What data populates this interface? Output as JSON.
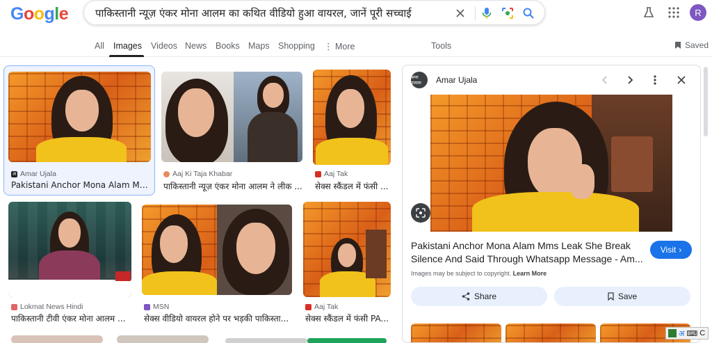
{
  "logo": {
    "letters": [
      "G",
      "o",
      "o",
      "g",
      "l",
      "e"
    ],
    "colors": [
      "#4285f4",
      "#ea4335",
      "#fbbc05",
      "#4285f4",
      "#34a853",
      "#ea4335"
    ]
  },
  "search": {
    "query": "पाकिस्तानी न्यूज़ एंकर मोना आलम का कथित वीडियो हुआ वायरल, जानें पूरी सच्चाई"
  },
  "header": {
    "avatar_letter": "R"
  },
  "nav": {
    "tabs": [
      "All",
      "Images",
      "Videos",
      "News",
      "Books",
      "Maps",
      "Shopping",
      "More",
      "Tools"
    ],
    "active": "Images",
    "saved_label": "Saved"
  },
  "results": [
    {
      "source": "Amar Ujala",
      "caption": "Pakistani Anchor Mona Alam Mms Le...",
      "fav_color": "#202124",
      "fav_text": "अ"
    },
    {
      "source": "Aaj Ki Taja Khabar",
      "caption": "पाकिस्तानी न्यूज़ एंकर मोना आलम ने लीक ...",
      "fav_color": "#e98a5e",
      "fav_text": ""
    },
    {
      "source": "Aaj Tak",
      "caption": "सेक्स स्कैंडल में फंसी ...",
      "fav_color": "#d93025",
      "fav_text": ""
    },
    {
      "source": "Lokmat News Hindi",
      "caption": "पाकिस्तानी टीवी एंकर मोना आलम ...",
      "fav_color": "#e06666",
      "fav_text": ""
    },
    {
      "source": "MSN",
      "caption": "सेक्स वीडियो वायरल होने पर भड़की पाकिस्ता...",
      "fav_color": "#7e57c2",
      "fav_text": ""
    },
    {
      "source": "Aaj Tak",
      "caption": "सेक्स स्कैंडल में फंसी PA...",
      "fav_color": "#d93025",
      "fav_text": ""
    }
  ],
  "panel": {
    "site": "Amar Ujala",
    "favicon_text": "अमर उजाला",
    "title": "Pakistani Anchor Mona Alam Mms Leak She Break Silence And Said Through Whatsapp Message - Am...",
    "visit_label": "Visit",
    "copyright_text": "Images may be subject to copyright.",
    "learn_more": "Learn More",
    "share_label": "Share",
    "save_label": "Save"
  },
  "ime": {
    "text": "अ"
  }
}
